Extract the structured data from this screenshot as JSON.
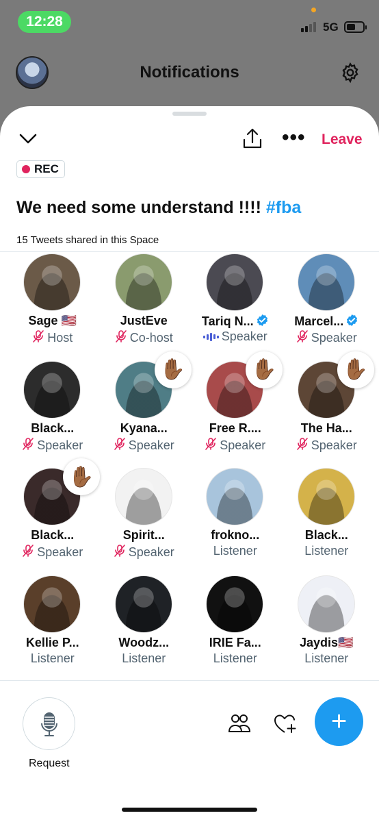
{
  "status_bar": {
    "time": "12:28",
    "network": "5G"
  },
  "header": {
    "title": "Notifications"
  },
  "space": {
    "leave_label": "Leave",
    "rec_label": "REC",
    "title": "We need some understand !!!!",
    "hashtag": "#fba",
    "shared_text": "15 Tweets shared in this Space"
  },
  "participants": [
    {
      "name": "Sage 🇺🇸",
      "role": "Host",
      "mic": "muted",
      "hand": false,
      "verified": false,
      "bg": "#6b5a48"
    },
    {
      "name": "JustEve",
      "role": "Co-host",
      "mic": "muted",
      "hand": false,
      "verified": false,
      "bg": "#8a9b6e"
    },
    {
      "name": "Tariq N...",
      "role": "Speaker",
      "mic": "speaking",
      "hand": false,
      "verified": true,
      "bg": "#4b4a52"
    },
    {
      "name": "Marcel...",
      "role": "Speaker",
      "mic": "muted",
      "hand": false,
      "verified": true,
      "bg": "#5f8db8"
    },
    {
      "name": "Black...",
      "role": "Speaker",
      "mic": "muted",
      "hand": false,
      "verified": false,
      "bg": "#2c2c2c"
    },
    {
      "name": "Kyana...",
      "role": "Speaker",
      "mic": "muted",
      "hand": true,
      "verified": false,
      "bg": "#4f7d86"
    },
    {
      "name": "Free R....",
      "role": "Speaker",
      "mic": "muted",
      "hand": true,
      "verified": false,
      "bg": "#a84b4b"
    },
    {
      "name": "The Ha...",
      "role": "Speaker",
      "mic": "muted",
      "hand": true,
      "verified": false,
      "bg": "#5d4636"
    },
    {
      "name": "Black...",
      "role": "Speaker",
      "mic": "muted",
      "hand": true,
      "verified": false,
      "bg": "#3a2a2a"
    },
    {
      "name": "Spirit...",
      "role": "Speaker",
      "mic": "muted",
      "hand": false,
      "verified": false,
      "bg": "#f2f2f2"
    },
    {
      "name": "frokno...",
      "role": "Listener",
      "mic": "none",
      "hand": false,
      "verified": false,
      "bg": "#a8c4dc"
    },
    {
      "name": "Black...",
      "role": "Listener",
      "mic": "none",
      "hand": false,
      "verified": false,
      "bg": "#d4b24a"
    },
    {
      "name": "Kellie P...",
      "role": "Listener",
      "mic": "none",
      "hand": false,
      "verified": false,
      "bg": "#5a3f2a"
    },
    {
      "name": "Woodz...",
      "role": "Listener",
      "mic": "none",
      "hand": false,
      "verified": false,
      "bg": "#1f2226"
    },
    {
      "name": "IRIE Fa...",
      "role": "Listener",
      "mic": "none",
      "hand": false,
      "verified": false,
      "bg": "#111111"
    },
    {
      "name": "Jaydis🇺🇸",
      "role": "Listener",
      "mic": "none",
      "hand": false,
      "verified": false,
      "bg": "#eef0f6"
    }
  ],
  "bottom_bar": {
    "request_label": "Request"
  },
  "colors": {
    "accent": "#1d9bf0",
    "leave": "#e0245e",
    "muted_mic": "#e0245e",
    "speaking_bars": "#4a5fd6"
  },
  "icons": [
    "chevron-down-icon",
    "share-icon",
    "more-icon",
    "gear-icon",
    "microphone-icon",
    "people-icon",
    "heart-plus-icon",
    "plus-icon",
    "raised-hand-icon",
    "verified-icon"
  ]
}
